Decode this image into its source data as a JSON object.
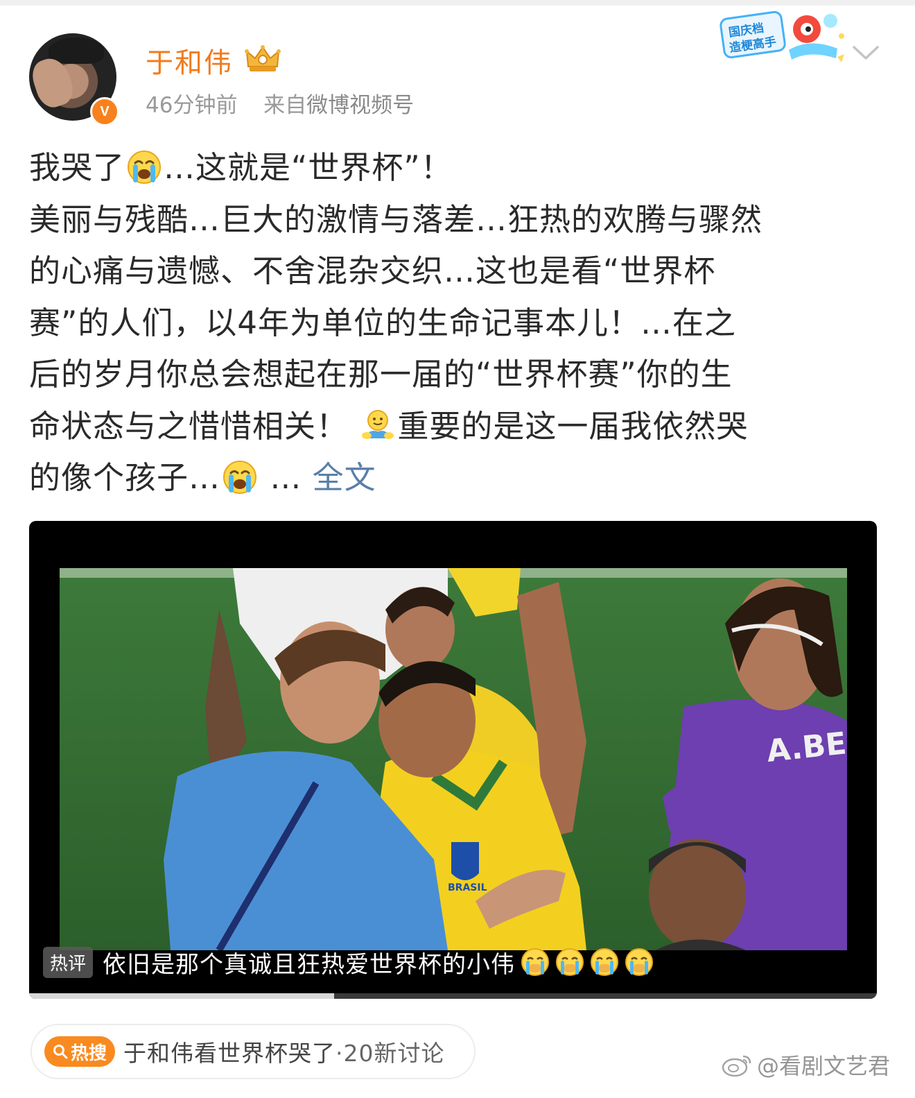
{
  "header": {
    "username": "于和伟",
    "time": "46分钟前",
    "source_prefix": "来自",
    "source_link": "微博视频号",
    "verified_badge": "V",
    "promo_badge_lines": [
      "国庆档",
      "造梗高手"
    ]
  },
  "post": {
    "line1_a": "我哭了",
    "line1_b": "…这就是“世界杯”！",
    "line2": "美丽与残酷…巨大的激情与落差…狂热的欢腾与骤然",
    "line3": "的心痛与遗憾、不舍混杂交织…这也是看“世界杯",
    "line4": "赛”的人们，以4年为单位的生命记事本儿！…在之",
    "line5": "后的岁月你总会想起在那一届的“世界杯赛”你的生",
    "line6_a": "命状态与之惜惜相关！",
    "line6_b": "重要的是这一届我依然哭",
    "line7_a": "的像个孩子…",
    "line7_b": " … ",
    "full_text_link": "全文"
  },
  "video": {
    "jersey_text": "A.BECK",
    "crest_text": "BRASIL",
    "hot_tag": "热评",
    "hot_comment": "依旧是那个真诚且狂热爱世界杯的小伟",
    "progress_fraction": 0.36
  },
  "hot_search": {
    "badge": "热搜",
    "topic": "于和伟看世界杯哭了",
    "count": "·20新讨论"
  },
  "watermark": "@看剧文艺君",
  "icons": {
    "crown": "crown-icon",
    "chevron": "chevron-down-icon",
    "emoji_cry": "crying-face-icon",
    "emoji_hug": "hug-icon",
    "search": "search-icon",
    "weibo": "weibo-logo-icon"
  },
  "colors": {
    "username": "#f37a1c",
    "link": "#5a7fa8",
    "meta": "#999999",
    "hot_search_badge": "#f98a1f"
  }
}
